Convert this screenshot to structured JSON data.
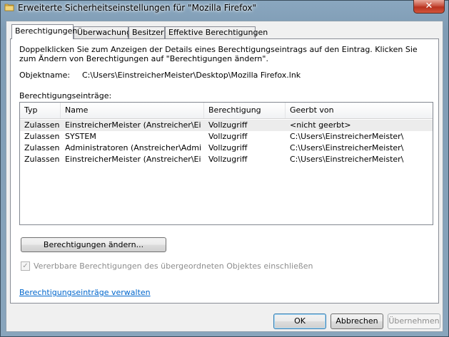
{
  "window": {
    "title": "Erweiterte Sicherheitseinstellungen für \"Mozilla Firefox\"",
    "close_glyph": "✕"
  },
  "tabs": [
    {
      "label": "Berechtigungen",
      "active": true
    },
    {
      "label": "Überwachung",
      "active": false
    },
    {
      "label": "Besitzer",
      "active": false
    },
    {
      "label": "Effektive Berechtigungen",
      "active": false
    }
  ],
  "panel": {
    "intro": "Doppelklicken Sie zum Anzeigen der Details eines Berechtigungseintrags auf den Eintrag. Klicken Sie zum Ändern von Berechtigungen auf \"Berechtigungen ändern\".",
    "object_label": "Objektname:",
    "object_value": "C:\\Users\\EinstreicherMeister\\Desktop\\Mozilla Firefox.lnk",
    "entries_label": "Berechtigungseinträge:",
    "columns": [
      "Typ",
      "Name",
      "Berechtigung",
      "Geerbt von"
    ],
    "rows": [
      {
        "typ": "Zulassen",
        "name": "EinstreicherMeister (Anstreicher\\Einstr...",
        "perm": "Vollzugriff",
        "inherited": "<nicht geerbt>",
        "selected": true
      },
      {
        "typ": "Zulassen",
        "name": "SYSTEM",
        "perm": "Vollzugriff",
        "inherited": "C:\\Users\\EinstreicherMeister\\",
        "selected": false
      },
      {
        "typ": "Zulassen",
        "name": "Administratoren (Anstreicher\\Administr...",
        "perm": "Vollzugriff",
        "inherited": "C:\\Users\\EinstreicherMeister\\",
        "selected": false
      },
      {
        "typ": "Zulassen",
        "name": "EinstreicherMeister (Anstreicher\\Einstr...",
        "perm": "Vollzugriff",
        "inherited": "C:\\Users\\EinstreicherMeister\\",
        "selected": false
      }
    ],
    "change_button": "Berechtigungen ändern...",
    "inherit_checkbox_label": "Vererbbare Berechtigungen des übergeordneten Objektes einschließen",
    "inherit_checked": true,
    "manage_link": "Berechtigungseinträge verwalten"
  },
  "buttons": {
    "ok": "OK",
    "cancel": "Abbrechen",
    "apply": "Übernehmen"
  }
}
